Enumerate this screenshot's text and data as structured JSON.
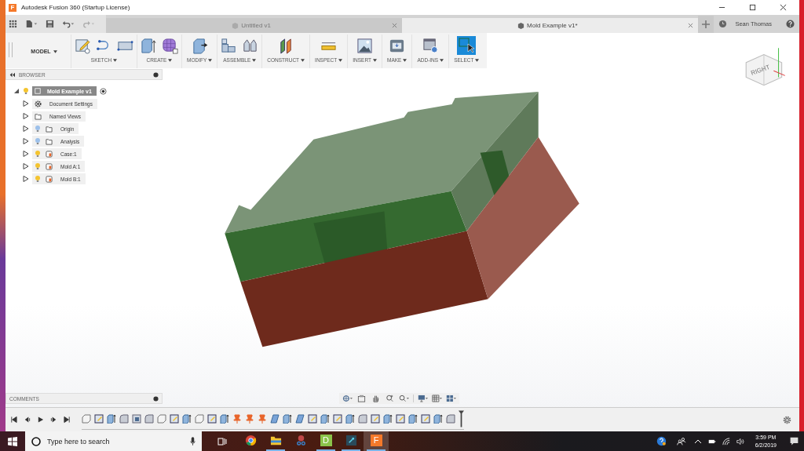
{
  "window": {
    "icon_letter": "F",
    "title": "Autodesk Fusion 360 (Startup License)"
  },
  "tabs": [
    {
      "label": "Untitled v1",
      "selected": false
    },
    {
      "label": "Mold Example v1*",
      "selected": true
    }
  ],
  "user": "Sean Thomas",
  "workspace": "MODEL",
  "toolbar_groups": [
    {
      "label": "SKETCH"
    },
    {
      "label": "CREATE"
    },
    {
      "label": "MODIFY"
    },
    {
      "label": "ASSEMBLE"
    },
    {
      "label": "CONSTRUCT"
    },
    {
      "label": "INSPECT"
    },
    {
      "label": "INSERT"
    },
    {
      "label": "MAKE"
    },
    {
      "label": "ADD-INS"
    },
    {
      "label": "SELECT"
    }
  ],
  "browser": {
    "title": "BROWSER",
    "root": {
      "label": "Mold Example v1",
      "visible": true,
      "children": [
        {
          "label": "Document Settings",
          "kind": "settings"
        },
        {
          "label": "Named Views",
          "kind": "views"
        },
        {
          "label": "Origin",
          "kind": "folder",
          "visible": false
        },
        {
          "label": "Analysis",
          "kind": "folder",
          "visible": false
        },
        {
          "label": "Case:1",
          "kind": "component",
          "visible": true
        },
        {
          "label": "Mold A:1",
          "kind": "component",
          "visible": true
        },
        {
          "label": "Mold B:1",
          "kind": "component",
          "visible": true
        }
      ]
    }
  },
  "viewcube": {
    "face": "RIGHT"
  },
  "comments": {
    "title": "COMMENTS"
  },
  "timeline": {
    "features": [
      {
        "kind": "box"
      },
      {
        "kind": "sketch"
      },
      {
        "kind": "extrude"
      },
      {
        "kind": "fillet"
      },
      {
        "kind": "combine"
      },
      {
        "kind": "fillet"
      },
      {
        "kind": "box"
      },
      {
        "kind": "sketch"
      },
      {
        "kind": "extrude"
      },
      {
        "kind": "box"
      },
      {
        "kind": "sketch"
      },
      {
        "kind": "extrude"
      },
      {
        "kind": "pin"
      },
      {
        "kind": "pin"
      },
      {
        "kind": "pin"
      },
      {
        "kind": "move"
      },
      {
        "kind": "extrude"
      },
      {
        "kind": "move"
      },
      {
        "kind": "sketch"
      },
      {
        "kind": "extrude"
      },
      {
        "kind": "sketch"
      },
      {
        "kind": "extrude"
      },
      {
        "kind": "fillet"
      },
      {
        "kind": "sketch"
      },
      {
        "kind": "extrude"
      },
      {
        "kind": "sketch"
      },
      {
        "kind": "extrude"
      },
      {
        "kind": "sketch"
      },
      {
        "kind": "extrude"
      },
      {
        "kind": "fillet"
      }
    ]
  },
  "taskbar": {
    "search": {
      "placeholder": "Type here to search"
    },
    "apps": [
      {
        "kind": "chrome",
        "running": false,
        "selected": false
      },
      {
        "kind": "folder",
        "running": true,
        "selected": false
      },
      {
        "kind": "snip",
        "running": false,
        "selected": false
      },
      {
        "kind": "letter",
        "letter": "D",
        "color": "#8bc34a",
        "running": true,
        "selected": false
      },
      {
        "kind": "script",
        "running": true,
        "selected": false
      },
      {
        "kind": "letter",
        "letter": "F",
        "color": "#f5792a",
        "running": true,
        "selected": true
      }
    ],
    "time": "3:59 PM",
    "date": "6/2/2019"
  }
}
